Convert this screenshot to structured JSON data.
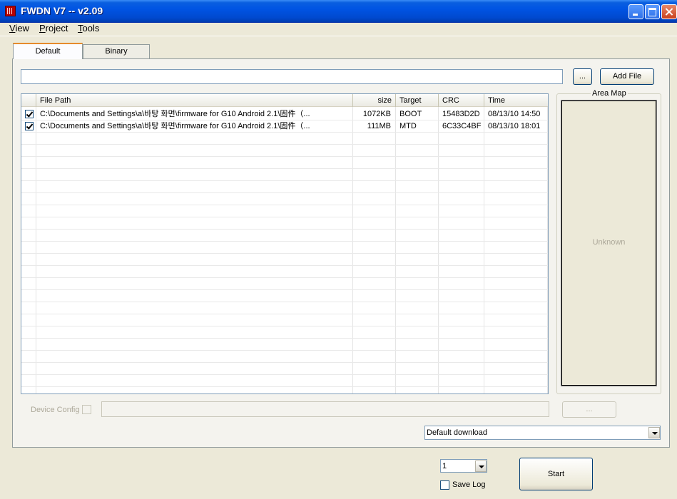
{
  "window": {
    "title": "FWDN V7 -- v2.09"
  },
  "menu": {
    "items": [
      {
        "mnemonic": "V",
        "rest": "iew"
      },
      {
        "mnemonic": "P",
        "rest": "roject"
      },
      {
        "mnemonic": "T",
        "rest": "ools"
      }
    ]
  },
  "tabs": [
    {
      "label": "Default",
      "selected": true
    },
    {
      "label": "Binary",
      "selected": false
    }
  ],
  "path_input": {
    "value": ""
  },
  "buttons": {
    "browse": "...",
    "add_file": "Add File",
    "device_config_browse": "...",
    "start": "Start"
  },
  "file_list": {
    "columns": [
      "File Path",
      "size",
      "Target",
      "CRC",
      "Time"
    ],
    "rows": [
      {
        "checked": true,
        "path": "C:\\Documents and Settings\\a\\바탕 화면\\firmware for G10 Android 2.1\\固件（...",
        "size": "1072KB",
        "target": "BOOT",
        "crc": "15483D2D",
        "time": "08/13/10 14:50"
      },
      {
        "checked": true,
        "path": "C:\\Documents and Settings\\a\\바탕 화면\\firmware for G10 Android 2.1\\固件（...",
        "size": "111MB",
        "target": "MTD",
        "crc": "6C33C4BF",
        "time": "08/13/10 18:01"
      }
    ]
  },
  "area_map": {
    "label": "Area Map",
    "status": "Unknown"
  },
  "device_config": {
    "label": "Device Config",
    "checked": false,
    "value": ""
  },
  "download_mode": {
    "selected": "Default download"
  },
  "count_select": {
    "selected": "1"
  },
  "save_log": {
    "label": "Save Log",
    "checked": false
  }
}
